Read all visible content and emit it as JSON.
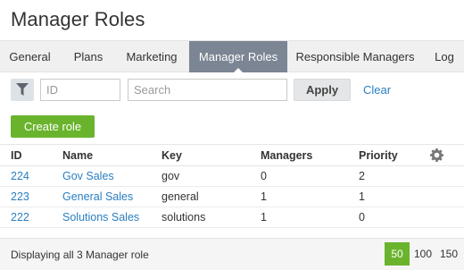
{
  "page": {
    "title": "Manager Roles"
  },
  "tabs": [
    {
      "label": "General"
    },
    {
      "label": "Plans"
    },
    {
      "label": "Marketing"
    },
    {
      "label": "Manager Roles",
      "active": true
    },
    {
      "label": "Responsible Managers"
    },
    {
      "label": "Log"
    }
  ],
  "filter": {
    "id_placeholder": "ID",
    "search_placeholder": "Search",
    "apply_label": "Apply",
    "clear_label": "Clear"
  },
  "create_label": "Create role",
  "table": {
    "columns": [
      "ID",
      "Name",
      "Key",
      "Managers",
      "Priority"
    ],
    "rows": [
      {
        "id": "224",
        "name": "Gov Sales",
        "key": "gov",
        "managers": "0",
        "priority": "2"
      },
      {
        "id": "223",
        "name": "General Sales",
        "key": "general",
        "managers": "1",
        "priority": "1"
      },
      {
        "id": "222",
        "name": "Solutions Sales",
        "key": "solutions",
        "managers": "1",
        "priority": "0"
      }
    ]
  },
  "footer": {
    "summary": "Displaying all 3 Manager role",
    "page_sizes": [
      "50",
      "100",
      "150"
    ],
    "selected_page_size": "50"
  },
  "colors": {
    "accent_green": "#6ab42d",
    "link_blue": "#2a7fc0",
    "active_tab": "#7b8593"
  }
}
